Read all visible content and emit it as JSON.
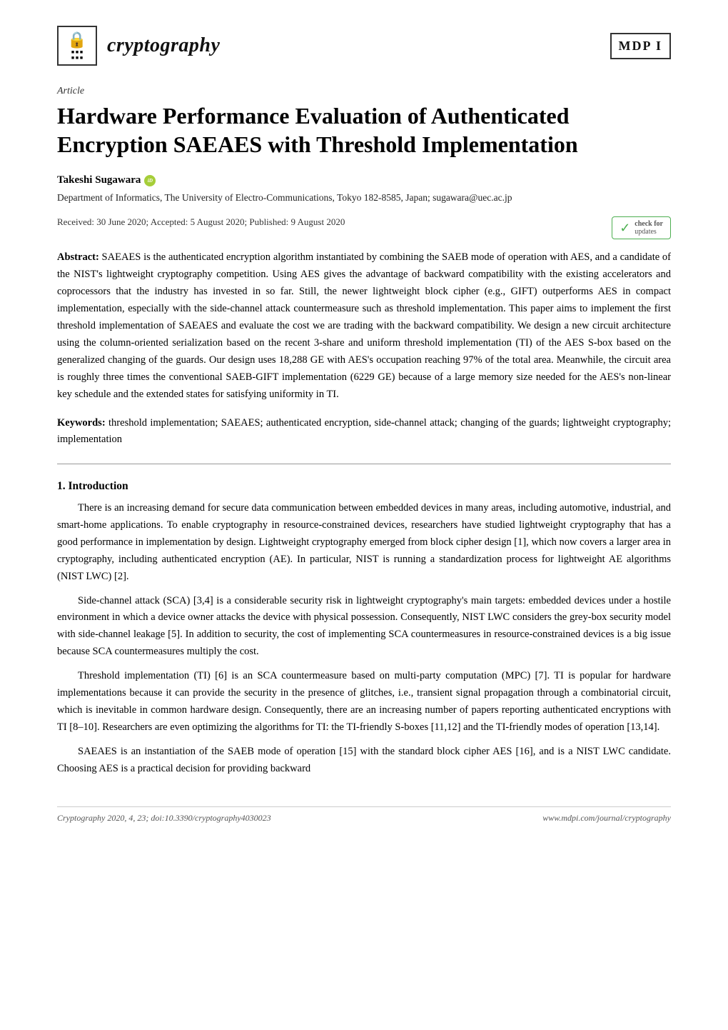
{
  "header": {
    "journal_name": "cryptography",
    "mdpi_label": "MDP I",
    "logo_lock": "🔒"
  },
  "article": {
    "type": "Article",
    "title": "Hardware Performance Evaluation of Authenticated Encryption SAEAES with Threshold Implementation",
    "authors": [
      {
        "name": "Takeshi Sugawara",
        "orcid": true
      }
    ],
    "affiliation": "Department of Informatics, The University of Electro-Communications, Tokyo 182-8585, Japan; sugawara@uec.ac.jp",
    "dates": "Received: 30 June 2020; Accepted: 5 August 2020; Published: 9 August 2020",
    "check_updates": {
      "line1": "check for",
      "line2": "updates"
    },
    "abstract_label": "Abstract:",
    "abstract": " SAEAES is the authenticated encryption algorithm instantiated by combining the SAEB mode of operation with AES, and a candidate of the NIST's lightweight cryptography competition. Using AES gives the advantage of backward compatibility with the existing accelerators and coprocessors that the industry has invested in so far.  Still, the newer lightweight block cipher (e.g., GIFT) outperforms AES in compact implementation, especially with the side-channel attack countermeasure such as threshold implementation. This paper aims to implement the first threshold implementation of SAEAES and evaluate the cost we are trading with the backward compatibility. We design a new circuit architecture using the column-oriented serialization based on the recent 3-share and uniform threshold implementation (TI) of the AES S-box based on the generalized changing of the guards. Our design uses 18,288 GE with AES's occupation reaching 97% of the total area. Meanwhile, the circuit area is roughly three times the conventional SAEB-GIFT implementation (6229 GE) because of a large memory size needed for the AES's non-linear key schedule and the extended states for satisfying uniformity in TI.",
    "keywords_label": "Keywords:",
    "keywords": " threshold implementation; SAEAES; authenticated encryption, side-channel attack; changing of the guards; lightweight cryptography; implementation",
    "section1_heading": "1. Introduction",
    "section1_paragraphs": [
      "There is an increasing demand for secure data communication between embedded devices in many areas, including automotive, industrial, and smart-home applications. To enable cryptography in resource-constrained devices, researchers have studied lightweight cryptography that has a good performance in implementation by design.  Lightweight cryptography emerged from block cipher design [1], which now covers a larger area in cryptography, including authenticated encryption (AE). In particular, NIST is running a standardization process for lightweight AE algorithms (NIST LWC) [2].",
      "Side-channel attack (SCA) [3,4] is a considerable security risk in lightweight cryptography's main targets: embedded devices under a hostile environment in which a device owner attacks the device with physical possession. Consequently, NIST LWC considers the grey-box security model with side-channel leakage [5]. In addition to security, the cost of implementing SCA countermeasures in resource-constrained devices is a big issue because SCA countermeasures multiply the cost.",
      "Threshold implementation (TI) [6] is an SCA countermeasure based on multi-party computation (MPC) [7].  TI is popular for hardware implementations because it can provide the security in the presence of glitches, i.e., transient signal propagation through a combinatorial circuit, which is inevitable in common hardware design. Consequently, there are an increasing number of papers reporting authenticated encryptions with TI [8–10]. Researchers are even optimizing the algorithms for TI: the TI-friendly S-boxes [11,12] and the TI-friendly modes of operation [13,14].",
      "SAEAES is an instantiation of the SAEB mode of operation [15] with the standard block cipher AES [16], and is a NIST LWC candidate. Choosing AES is a practical decision for providing backward"
    ]
  },
  "footer": {
    "left": "Cryptography 2020, 4, 23; doi:10.3390/cryptography4030023",
    "right": "www.mdpi.com/journal/cryptography"
  }
}
